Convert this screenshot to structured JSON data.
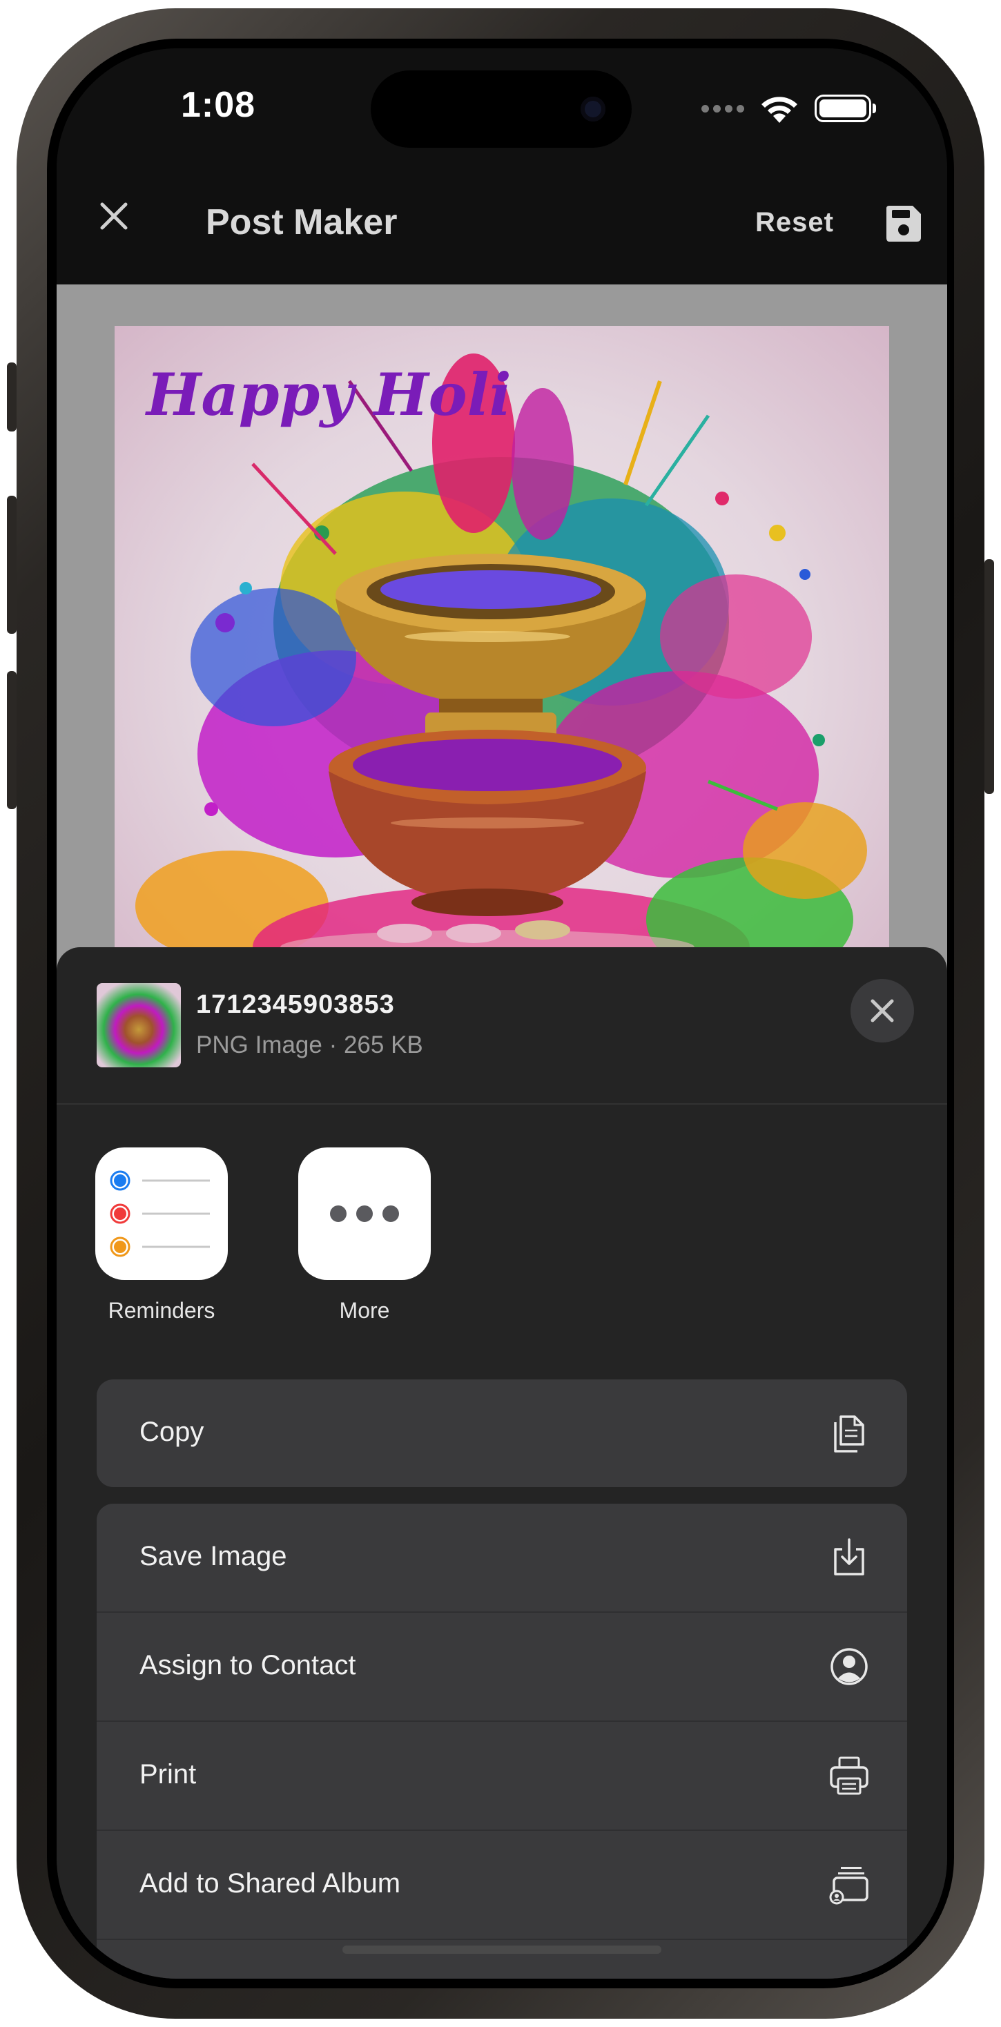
{
  "status_bar": {
    "time": "1:08"
  },
  "app_bar": {
    "title": "Post Maker",
    "reset_label": "Reset"
  },
  "post": {
    "headline": "Happy Holi"
  },
  "share_sheet": {
    "file_name": "1712345903853",
    "file_meta": "PNG Image · 265 KB",
    "apps": [
      {
        "label": "Reminders",
        "icon": "reminders-icon"
      },
      {
        "label": "More",
        "icon": "more-icon"
      }
    ],
    "actions_primary": [
      {
        "label": "Copy",
        "icon": "copy-icon"
      }
    ],
    "actions": [
      {
        "label": "Save Image",
        "icon": "save-image-icon"
      },
      {
        "label": "Assign to Contact",
        "icon": "contact-icon"
      },
      {
        "label": "Print",
        "icon": "printer-icon"
      },
      {
        "label": "Add to Shared Album",
        "icon": "shared-album-icon"
      }
    ]
  },
  "colors": {
    "sheet_bg": "#242424",
    "row_bg": "#3a3a3c",
    "appbar_bg": "#101010",
    "headline_purple": "#7a1cb8"
  }
}
